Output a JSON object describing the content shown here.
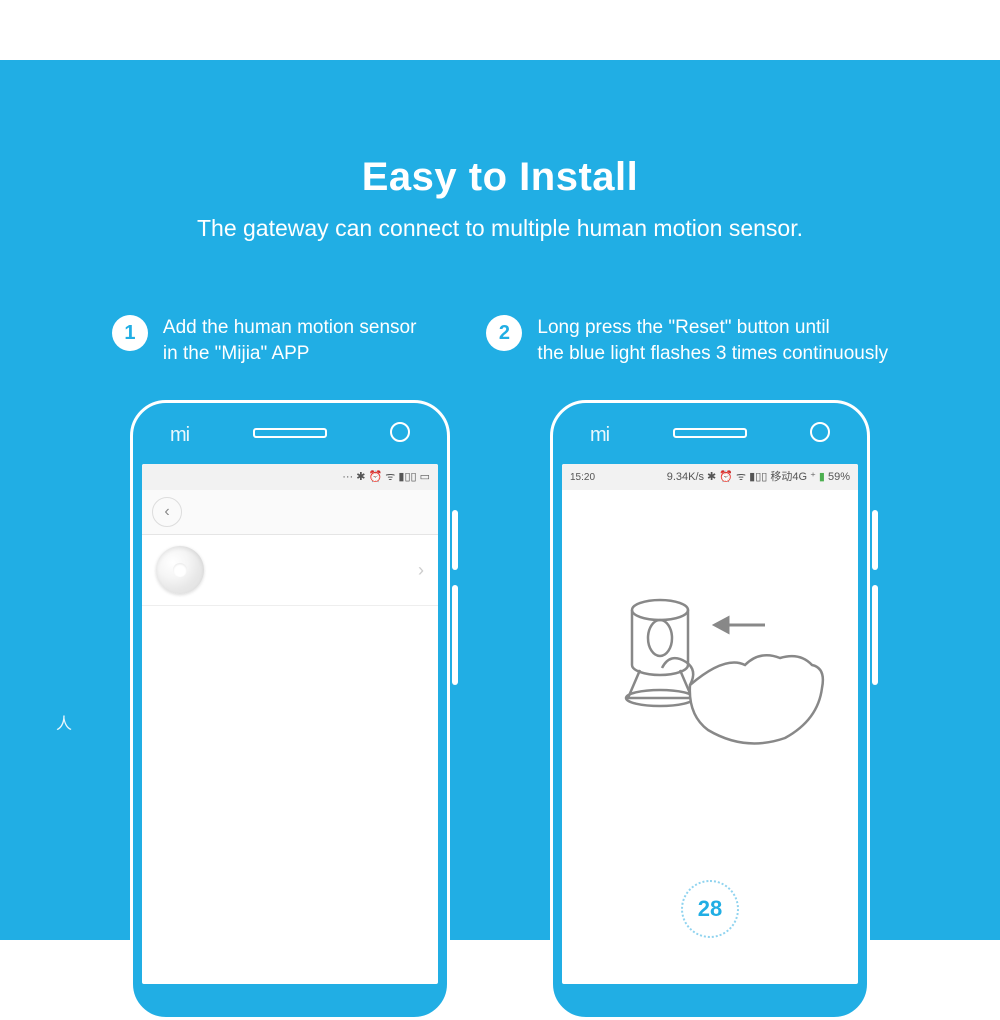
{
  "header": {
    "title": "Easy to Install",
    "subtitle": "The gateway can connect to multiple human motion sensor."
  },
  "steps": [
    {
      "num": "1",
      "text": "Add the human motion sensor\n in the \"Mijia\" APP"
    },
    {
      "num": "2",
      "text": "Long press the \"Reset\" button until\nthe blue light flashes 3 times continuously"
    }
  ],
  "phone_brand": "mi",
  "phone1": {
    "status_left": "",
    "status_right_icons": "···  ✱ ⏰ ᯤ ▮▯▯ ▭"
  },
  "phone2": {
    "status_time": "15:20",
    "status_net": "9.34K/s",
    "status_icons": "✱ ⏰ ᯤ ▮▯▯ 移动4G ⁺",
    "status_batt": "59%",
    "countdown": "28"
  },
  "edge_char": "人"
}
